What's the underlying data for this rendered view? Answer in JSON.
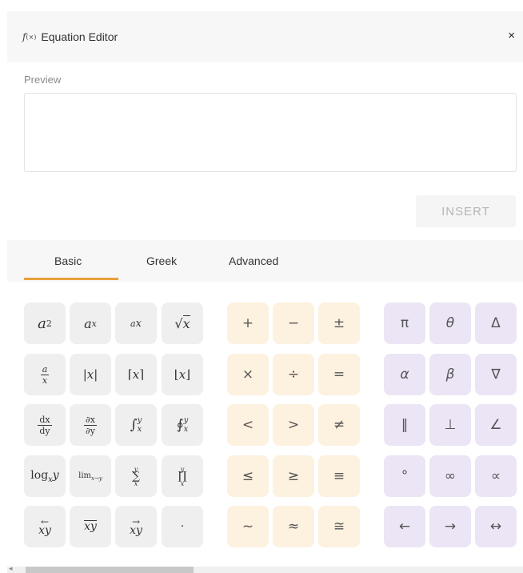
{
  "header": {
    "icon_text": "f(×)",
    "title": "Equation Editor",
    "close": "×"
  },
  "preview": {
    "label": "Preview",
    "value": ""
  },
  "insert_label": "INSERT",
  "tabs": [
    "Basic",
    "Greek",
    "Advanced"
  ],
  "accent_color": "#e8a13b",
  "operators": {
    "row1": [
      "+",
      "−",
      "±"
    ],
    "row2": [
      "×",
      "÷",
      "="
    ],
    "row3": [
      "<",
      ">",
      "≠"
    ],
    "row4": [
      "≤",
      "≥",
      "≡"
    ],
    "row5": [
      "~",
      "≈",
      "≅"
    ]
  },
  "greek_symbols": {
    "row1": [
      "π",
      "θ",
      "Δ"
    ],
    "row2": [
      "α",
      "β",
      "∇"
    ],
    "row3": [
      "‖",
      "⊥",
      "∠"
    ],
    "row4": [
      "°",
      "∞",
      "∝"
    ],
    "row5": [
      "←",
      "→",
      "↔"
    ]
  }
}
